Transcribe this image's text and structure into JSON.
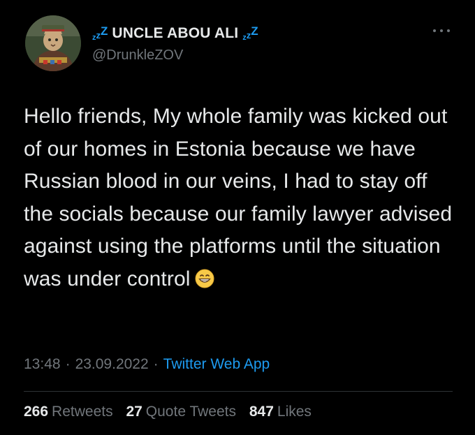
{
  "colors": {
    "background": "#000000",
    "text_primary": "#e7e9ea",
    "text_secondary": "#71767b",
    "accent": "#1d9bf0",
    "divider": "#2f3336"
  },
  "author": {
    "zzz_left": "zzZ",
    "display_name": "UNCLE ABOU ALI",
    "zzz_right": "zzZ",
    "handle": "@DrunkleZOV",
    "avatar_icon": "avatar-cat-in-uniform"
  },
  "menu": {
    "icon": "more-horizontal-icon"
  },
  "tweet": {
    "text": "Hello friends, My whole family was kicked out of our homes in Estonia because we have Russian blood in our veins, I had to stay off the socials because our family lawyer advised against using the platforms until the situation was under control",
    "emoji": "grinning-face-emoji"
  },
  "meta": {
    "time": "13:48",
    "separator": "·",
    "date": "23.09.2022",
    "source": "Twitter Web App"
  },
  "stats": [
    {
      "count": "266",
      "label": "Retweets"
    },
    {
      "count": "27",
      "label": "Quote Tweets"
    },
    {
      "count": "847",
      "label": "Likes"
    }
  ]
}
